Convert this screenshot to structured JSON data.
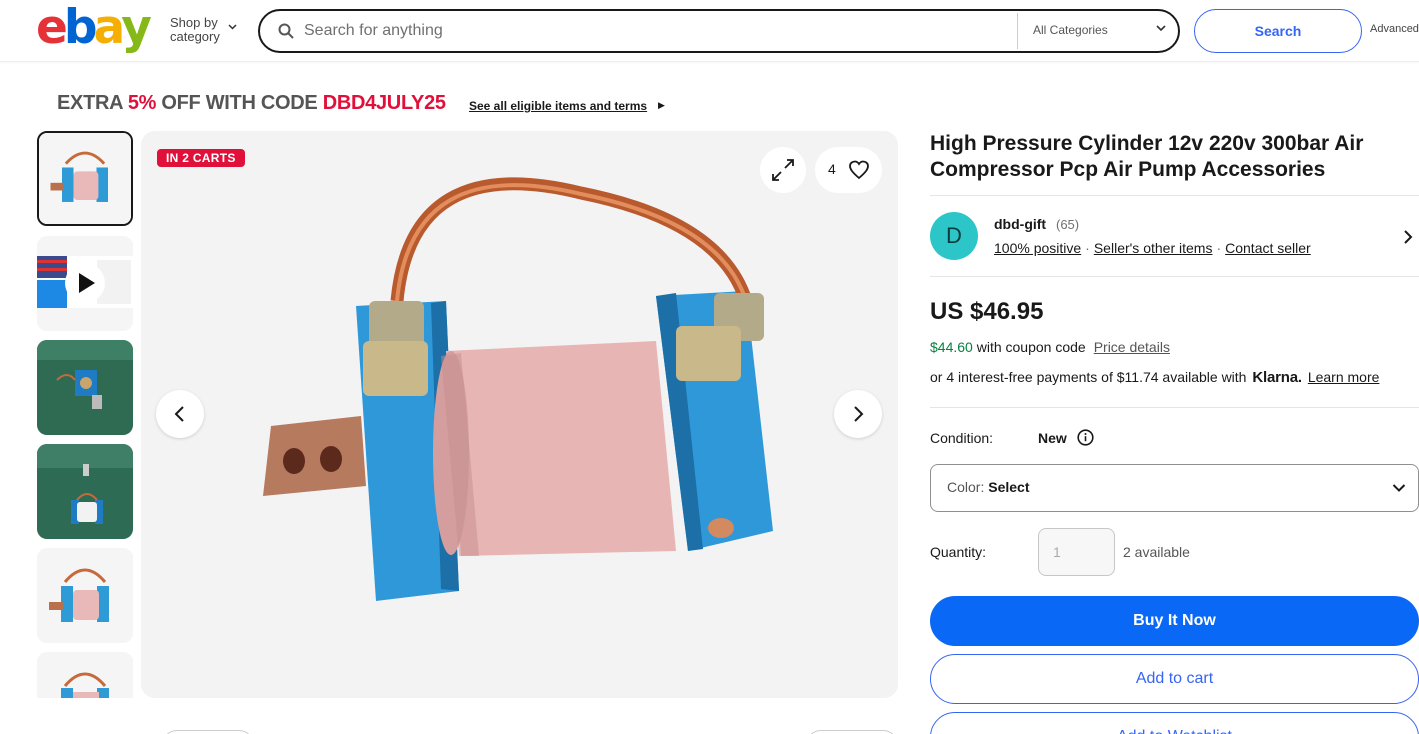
{
  "header": {
    "logo_letters": [
      "e",
      "b",
      "a",
      "y"
    ],
    "shop_by_line1": "Shop by",
    "shop_by_line2": "category",
    "search_placeholder": "Search for anything",
    "category_select": "All Categories",
    "search_button": "Search",
    "advanced_link": "Advanced"
  },
  "promo": {
    "prefix": "EXTRA ",
    "percent": "5%",
    "middle": " OFF WITH CODE ",
    "code": "DBD4JULY25",
    "link": "See all eligible items and terms"
  },
  "gallery": {
    "badge": "IN 2 CARTS",
    "watch_count": "4",
    "thumbnail_count": 6
  },
  "product": {
    "title": "High Pressure Cylinder 12v 220v 300bar Air Compressor Pcp Air Pump Accessories",
    "seller": {
      "initial": "D",
      "name": "dbd-gift",
      "feedback_count": "(65)",
      "positive": "100% positive",
      "other_items": "Seller's other items",
      "contact": "Contact seller"
    },
    "price": "US $46.95",
    "coupon_price": "$44.60",
    "coupon_text": " with coupon code",
    "price_details": "Price details",
    "klarna_prefix": "or 4 interest-free payments of $11.74 available with",
    "klarna_brand": "Klarna.",
    "klarna_learn": "Learn more",
    "condition_label": "Condition:",
    "condition_value": "New",
    "color_label": "Color: ",
    "color_value": "Select",
    "quantity_label": "Quantity:",
    "quantity_value": "1",
    "quantity_available": "2 available",
    "buy_now": "Buy It Now",
    "add_to_cart": "Add to cart",
    "add_to_watchlist": "Add to Watchlist"
  },
  "colors": {
    "ebay_red": "#e53238",
    "ebay_blue": "#0064d2",
    "ebay_yellow": "#f5af02",
    "ebay_green": "#86b817",
    "accent_blue": "#3665f3",
    "buy_blue": "#0968f6",
    "promo_red": "#e0103a",
    "coupon_green": "#05823f"
  }
}
